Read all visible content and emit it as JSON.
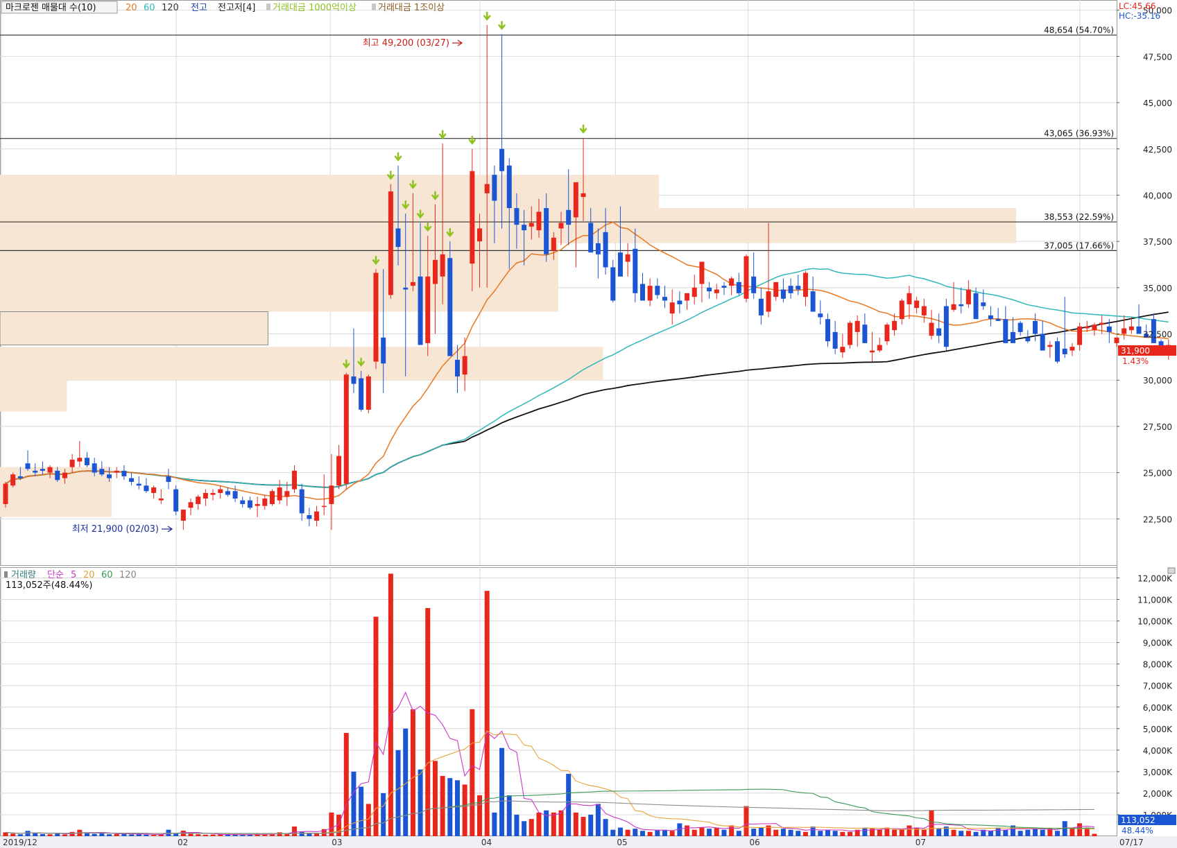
{
  "header": {
    "title": "마크로젠 매물대 수(10)",
    "ma_periods": [
      "20",
      "60",
      "120"
    ],
    "ma_colors": [
      "#e87722",
      "#30b8b8",
      "#111111"
    ],
    "prev_high_label": "전고",
    "prev_high_low_label": "전고저[4]",
    "volume_filter_1": "거래대금 1000억이상",
    "volume_filter_2": "거래대금 1조이상"
  },
  "corner": {
    "lc": "LC:45.66",
    "hc": "HC:-35.16"
  },
  "price_annotations": {
    "high": "최고 49,200 (03/27)",
    "low": "최저 21,900 (02/03)"
  },
  "price_axis_labels": [
    "50,000",
    "47,500",
    "45,000",
    "42,500",
    "40,000",
    "37,500",
    "35,000",
    "32,500",
    "30,000",
    "27,500",
    "25,000",
    "22,500"
  ],
  "volume_axis_labels": [
    "12,000K",
    "11,000K",
    "10,000K",
    "9,000K",
    "8,000K",
    "7,000K",
    "6,000K",
    "5,000K",
    "4,000K",
    "3,000K",
    "2,000K",
    "1,000K"
  ],
  "current_price": {
    "value": "31,900",
    "change": "1.43%"
  },
  "current_volume": {
    "value": "113,052",
    "ratio": "48.44%"
  },
  "volume_legend": {
    "label": "거래량",
    "ma_label": "단순",
    "periods": [
      "5",
      "20",
      "60",
      "120"
    ],
    "summary": "113,052주(48.44%)"
  },
  "date_labels": [
    "2019/12",
    "02",
    "03",
    "04",
    "05",
    "06",
    "07",
    "07/17"
  ],
  "colors": {
    "up": "#e8261c",
    "down": "#1c55d4",
    "zone": "#f7e6d4",
    "arrow": "#8ec21f",
    "grid": "#d8d8d8",
    "ma5": "#c837c8",
    "ma20": "#e8a33a",
    "ma60": "#3a9a55",
    "ma120": "#8a8a8a"
  },
  "chart_data": {
    "type": "candlestick",
    "title": "마크로젠 매물대 수(10)",
    "ylim": [
      20000,
      50400
    ],
    "volume_ylim": [
      0,
      12500
    ],
    "volume_unit": "K",
    "resistance_lines": [
      {
        "price": 48654,
        "label": "48,654 (54.70%)"
      },
      {
        "price": 43065,
        "label": "43,065 (36.93%)"
      },
      {
        "price": 38553,
        "label": "38,553 (22.59%)"
      },
      {
        "price": 37005,
        "label": "37,005 (17.66%)"
      }
    ],
    "volume_profile_zones": [
      {
        "price_from": 38600,
        "price_to": 41100,
        "extent": 0.59
      },
      {
        "price_from": 37400,
        "price_to": 39300,
        "extent": 0.91
      },
      {
        "price_from": 33700,
        "price_to": 38600,
        "extent": 0.5
      },
      {
        "price_from": 31900,
        "price_to": 33700,
        "extent": 0.24
      },
      {
        "price_from": 30000,
        "price_to": 31800,
        "extent": 0.54
      },
      {
        "price_from": 28300,
        "price_to": 30000,
        "extent": 0.06
      },
      {
        "price_from": 22600,
        "price_to": 25300,
        "extent": 0.1
      }
    ],
    "ohlc": [
      [
        23300,
        24500,
        23100,
        24400
      ],
      [
        24300,
        25000,
        24200,
        24900
      ],
      [
        24800,
        25300,
        24600,
        24700
      ],
      [
        25500,
        26200,
        25100,
        25200
      ],
      [
        25100,
        25500,
        24800,
        25000
      ],
      [
        25200,
        25600,
        24900,
        25100
      ],
      [
        25000,
        25400,
        24700,
        25300
      ],
      [
        25100,
        25300,
        24500,
        24600
      ],
      [
        24700,
        25200,
        24400,
        25000
      ],
      [
        25300,
        26000,
        25000,
        25700
      ],
      [
        25600,
        26700,
        25300,
        25800
      ],
      [
        25800,
        26100,
        25300,
        25400
      ],
      [
        25500,
        25800,
        24800,
        25000
      ],
      [
        25200,
        25600,
        24800,
        24900
      ],
      [
        24900,
        25300,
        24500,
        24700
      ],
      [
        25000,
        25300,
        24700,
        25100
      ],
      [
        25100,
        25400,
        24600,
        24800
      ],
      [
        24700,
        25000,
        24300,
        24500
      ],
      [
        24400,
        24800,
        24100,
        24300
      ],
      [
        24300,
        24700,
        23900,
        24000
      ],
      [
        23900,
        24300,
        23600,
        24200
      ],
      [
        23500,
        24100,
        23300,
        23600
      ],
      [
        24800,
        25200,
        24100,
        24500
      ],
      [
        24100,
        24300,
        22700,
        22900
      ],
      [
        22400,
        23000,
        21900,
        23000
      ],
      [
        23100,
        23600,
        22700,
        23400
      ],
      [
        23300,
        23800,
        23000,
        23700
      ],
      [
        23600,
        24100,
        23200,
        23900
      ],
      [
        23800,
        24100,
        23500,
        23900
      ],
      [
        23900,
        24300,
        23600,
        24100
      ],
      [
        24000,
        24200,
        23700,
        23800
      ],
      [
        24000,
        24300,
        23400,
        23600
      ],
      [
        23500,
        23700,
        23100,
        23300
      ],
      [
        23500,
        23700,
        23000,
        23100
      ],
      [
        23200,
        23700,
        22600,
        23300
      ],
      [
        23200,
        23800,
        23000,
        23600
      ],
      [
        23300,
        24100,
        23200,
        24000
      ],
      [
        23500,
        24600,
        23300,
        24200
      ],
      [
        23700,
        24500,
        23200,
        24000
      ],
      [
        24100,
        25400,
        23900,
        25100
      ],
      [
        24100,
        24400,
        22400,
        22800
      ],
      [
        22700,
        23100,
        22100,
        22500
      ],
      [
        22400,
        23200,
        22100,
        22900
      ],
      [
        23200,
        24900,
        22700,
        23200
      ],
      [
        23300,
        26000,
        21900,
        24300
      ],
      [
        24300,
        26500,
        24100,
        25900
      ],
      [
        24400,
        30400,
        24100,
        30300
      ],
      [
        30200,
        32800,
        29300,
        29800
      ],
      [
        30100,
        30500,
        28300,
        28400
      ],
      [
        28400,
        30300,
        28200,
        30200
      ],
      [
        31000,
        36000,
        30600,
        35800
      ],
      [
        32300,
        36000,
        29300,
        30900
      ],
      [
        34600,
        40600,
        34400,
        40200
      ],
      [
        38200,
        41600,
        36200,
        37200
      ],
      [
        35000,
        39000,
        30200,
        34900
      ],
      [
        35100,
        40100,
        34800,
        35300
      ],
      [
        35600,
        38500,
        31900,
        31900
      ],
      [
        32000,
        37800,
        31300,
        35600
      ],
      [
        35200,
        39500,
        32500,
        36500
      ],
      [
        35600,
        42800,
        34100,
        36800
      ],
      [
        36600,
        37500,
        32700,
        31300
      ],
      [
        31100,
        31900,
        29300,
        30200
      ],
      [
        30300,
        32300,
        29400,
        31300
      ],
      [
        36300,
        42500,
        34800,
        41300
      ],
      [
        37500,
        39000,
        35000,
        38200
      ],
      [
        40100,
        49200,
        35000,
        40600
      ],
      [
        41100,
        41600,
        37400,
        39700
      ],
      [
        42500,
        48700,
        38200,
        41300
      ],
      [
        41600,
        42000,
        36000,
        39300
      ],
      [
        39300,
        40100,
        37100,
        38400
      ],
      [
        38400,
        39200,
        36200,
        38100
      ],
      [
        38300,
        39400,
        37600,
        38500
      ],
      [
        38100,
        39800,
        37700,
        39100
      ],
      [
        39300,
        40100,
        36400,
        36800
      ],
      [
        37000,
        38000,
        36500,
        37700
      ],
      [
        38200,
        39100,
        37300,
        38500
      ],
      [
        39200,
        41400,
        37300,
        38400
      ],
      [
        38800,
        40400,
        36100,
        40700
      ],
      [
        39900,
        43100,
        38600,
        40100
      ],
      [
        38500,
        39300,
        37900,
        36900
      ],
      [
        37400,
        38200,
        35500,
        36800
      ],
      [
        38000,
        39300,
        35700,
        36100
      ],
      [
        36100,
        36500,
        34200,
        34300
      ],
      [
        36900,
        39400,
        35800,
        35600
      ],
      [
        36400,
        37400,
        35600,
        36800
      ],
      [
        37100,
        38200,
        34200,
        34700
      ],
      [
        35200,
        35800,
        34500,
        34300
      ],
      [
        34300,
        35500,
        34000,
        35100
      ],
      [
        35100,
        35500,
        34400,
        34600
      ],
      [
        34500,
        35100,
        33900,
        34300
      ],
      [
        33600,
        34900,
        33000,
        34200
      ],
      [
        34300,
        34800,
        33600,
        34100
      ],
      [
        34300,
        34700,
        33800,
        34700
      ],
      [
        34500,
        35700,
        34100,
        35000
      ],
      [
        35200,
        36000,
        34200,
        36400
      ],
      [
        35000,
        35300,
        34400,
        34800
      ],
      [
        34700,
        35200,
        34400,
        34900
      ],
      [
        35100,
        35300,
        34600,
        35000
      ],
      [
        35100,
        35600,
        34600,
        35500
      ],
      [
        35300,
        35800,
        34600,
        34700
      ],
      [
        34400,
        36800,
        34200,
        36700
      ],
      [
        35600,
        36900,
        34400,
        34700
      ],
      [
        34400,
        35000,
        33000,
        33500
      ],
      [
        33700,
        38500,
        33400,
        34800
      ],
      [
        34500,
        35100,
        34300,
        35300
      ],
      [
        34900,
        35500,
        34200,
        34400
      ],
      [
        35100,
        35500,
        34400,
        34700
      ],
      [
        35100,
        35700,
        34600,
        34900
      ],
      [
        34500,
        35900,
        34000,
        35800
      ],
      [
        34800,
        35600,
        33900,
        33700
      ],
      [
        33600,
        34300,
        33000,
        33400
      ],
      [
        33300,
        33600,
        31800,
        32100
      ],
      [
        32600,
        33200,
        31400,
        31700
      ],
      [
        31500,
        32500,
        31200,
        31800
      ],
      [
        31900,
        33200,
        31700,
        33100
      ],
      [
        32600,
        33500,
        31800,
        33200
      ],
      [
        33000,
        33600,
        32000,
        32000
      ],
      [
        31500,
        32600,
        31000,
        31600
      ],
      [
        31600,
        32300,
        31500,
        31900
      ],
      [
        32100,
        33100,
        31900,
        33000
      ],
      [
        32700,
        33600,
        32400,
        33200
      ],
      [
        33300,
        34400,
        33000,
        34300
      ],
      [
        34100,
        35100,
        33300,
        34700
      ],
      [
        33900,
        34500,
        33600,
        34300
      ],
      [
        33500,
        34400,
        33100,
        34000
      ],
      [
        32400,
        33800,
        32200,
        33100
      ],
      [
        32800,
        33600,
        32000,
        32400
      ],
      [
        34000,
        34400,
        31600,
        31800
      ],
      [
        33800,
        35300,
        33700,
        34100
      ],
      [
        34100,
        35000,
        33600,
        34000
      ],
      [
        34100,
        35400,
        33900,
        34900
      ],
      [
        34700,
        35000,
        33900,
        33300
      ],
      [
        34200,
        34900,
        33800,
        34000
      ],
      [
        33500,
        34000,
        32900,
        33300
      ],
      [
        33300,
        33900,
        33200,
        33200
      ],
      [
        33300,
        34000,
        32300,
        32000
      ],
      [
        32600,
        33400,
        32300,
        32000
      ],
      [
        33100,
        33200,
        32400,
        32600
      ],
      [
        32300,
        32700,
        32000,
        32100
      ],
      [
        33200,
        33600,
        32100,
        32500
      ],
      [
        32500,
        33200,
        31600,
        31600
      ],
      [
        31800,
        32100,
        31200,
        31900
      ],
      [
        32100,
        32300,
        30900,
        31000
      ],
      [
        31700,
        34500,
        31200,
        31400
      ],
      [
        31600,
        32000,
        31300,
        31800
      ],
      [
        31900,
        33100,
        31600,
        32900
      ],
      [
        32800,
        33200,
        32600,
        32900
      ],
      [
        32700,
        33100,
        32400,
        33000
      ],
      [
        33000,
        33500,
        32500,
        33100
      ],
      [
        32900,
        33300,
        32000,
        32600
      ],
      [
        32000,
        32300,
        31800,
        32300
      ],
      [
        32500,
        33500,
        32200,
        32800
      ],
      [
        32700,
        33400,
        32500,
        32900
      ],
      [
        32900,
        34100,
        32500,
        32500
      ],
      [
        32500,
        33000,
        32400,
        32300
      ],
      [
        33300,
        33600,
        32200,
        32000
      ],
      [
        32100,
        32200,
        31500,
        31400
      ],
      [
        31400,
        32200,
        31100,
        31900
      ]
    ],
    "volume": [
      180,
      120,
      90,
      250,
      150,
      100,
      90,
      120,
      80,
      200,
      300,
      150,
      110,
      130,
      90,
      100,
      140,
      80,
      90,
      70,
      60,
      90,
      300,
      120,
      260,
      110,
      90,
      70,
      80,
      90,
      70,
      80,
      60,
      70,
      120,
      90,
      110,
      180,
      120,
      450,
      200,
      160,
      130,
      330,
      1100,
      1000,
      4800,
      3000,
      2300,
      1500,
      10200,
      2000,
      12200,
      4000,
      5000,
      5900,
      3100,
      10600,
      3500,
      2800,
      2700,
      2600,
      2400,
      5900,
      1900,
      11400,
      1100,
      4100,
      1900,
      1000,
      700,
      800,
      1100,
      1200,
      1100,
      1200,
      2900,
      1100,
      900,
      1000,
      1500,
      800,
      300,
      400,
      300,
      350,
      250,
      200,
      300,
      300,
      250,
      600,
      500,
      300,
      400,
      350,
      400,
      300,
      500,
      250,
      1400,
      350,
      400,
      500,
      300,
      350,
      300,
      250,
      200,
      450,
      250,
      300,
      250,
      200,
      200,
      300,
      400,
      350,
      300,
      400,
      300,
      350,
      500,
      400,
      300,
      1200,
      350,
      450,
      300,
      250,
      250,
      200,
      300,
      250,
      400,
      300,
      500,
      250,
      300,
      350,
      300,
      350,
      250,
      700,
      350,
      600,
      400,
      113
    ],
    "signal_arrows": {
      "high": [
        46,
        48,
        50,
        52,
        53,
        54,
        55,
        56,
        57,
        58,
        59,
        60,
        63,
        65,
        67,
        78
      ],
      "low": [
        24,
        44
      ]
    }
  }
}
